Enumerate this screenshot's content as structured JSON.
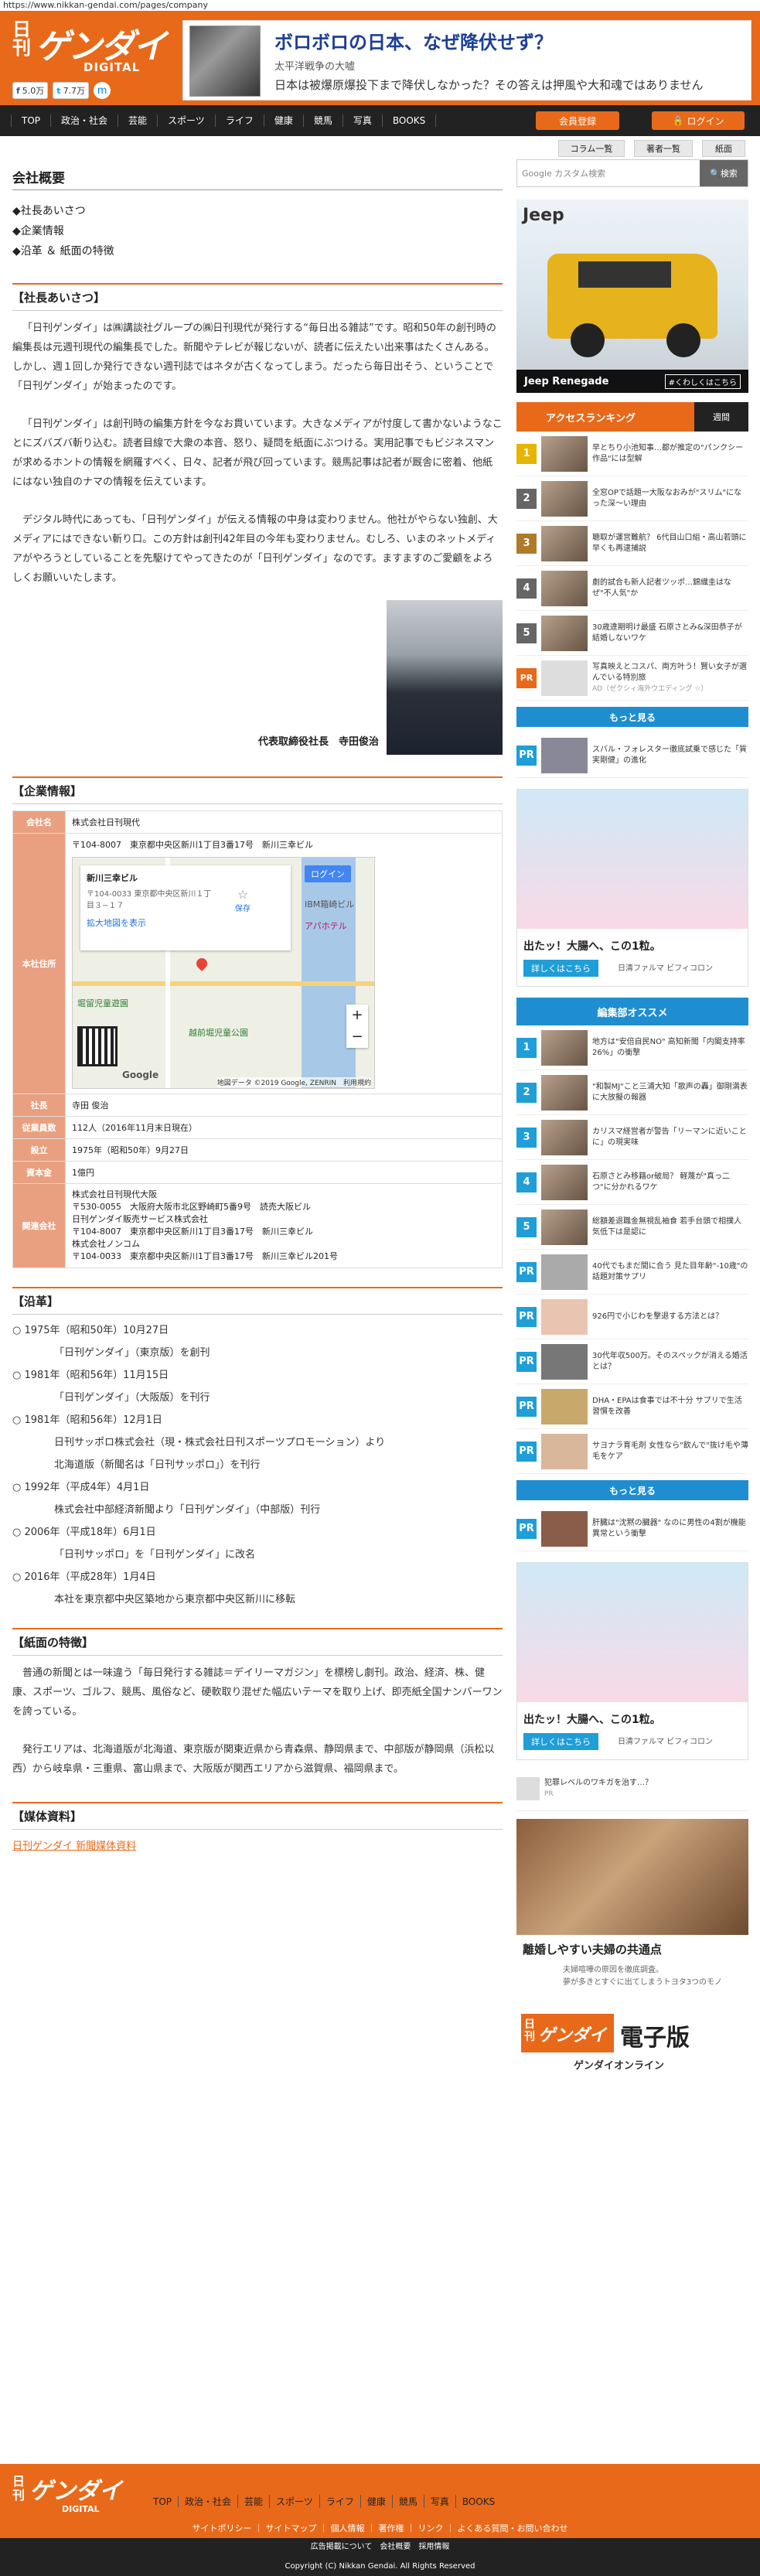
{
  "url": "https://www.nikkan-gendai.com/pages/company",
  "logo": {
    "nikkan": "日刊",
    "gendai": "ゲンダイ",
    "digital": "DIGITAL"
  },
  "social": {
    "fb_label": "f",
    "fb_count": "5.0万",
    "tw_label": "t",
    "tw_count": "7.7万",
    "messenger": "m"
  },
  "promo": {
    "headline": "ボロボロの日本、なぜ降伏せず？",
    "subtitle": "太平洋戦争の大嘘",
    "desc": "日本は被爆原爆投下まで降伏しなかった？その答えは押風や大和魂ではありません"
  },
  "nav": {
    "items": [
      "TOP",
      "政治・社会",
      "芸能",
      "スポーツ",
      "ライフ",
      "健康",
      "競馬",
      "写真",
      "BOOKS"
    ],
    "register": "会員登録",
    "login": "ログイン"
  },
  "subnav": [
    "コラム一覧",
    "著者一覧",
    "紙面"
  ],
  "page_title": "会社概要",
  "toc": [
    "◆社長あいさつ",
    "◆企業情報",
    "◆沿革 ＆ 紙面の特徴"
  ],
  "greeting": {
    "heading": "【社長あいさつ】",
    "p1": "「日刊ゲンダイ」は㈱講談社グループの㈱日刊現代が発行する“毎日出る雑誌”です。昭和50年の創刊時の編集長は元週刊現代の編集長でした。新聞やテレビが報じないが、読者に伝えたい出来事はたくさんある。しかし、週１回しか発行できない週刊誌ではネタが古くなってしまう。だったら毎日出そう、ということで「日刊ゲンダイ」が始まったのです。",
    "p2": "「日刊ゲンダイ」は創刊時の編集方針を今なお貫いています。大きなメディアが忖度して書かないようなことにズバズバ斬り込む。読者目線で大衆の本音、怒り、疑問を紙面にぶつける。実用記事でもビジネスマンが求めるホントの情報を網羅すべく、日々、記者が飛び回っています。競馬記事は記者が厩舎に密着、他紙にはない独自のナマの情報を伝えています。",
    "p3": "デジタル時代にあっても、「日刊ゲンダイ」が伝える情報の中身は変わりません。他社がやらない独創、大メディアにはできない斬り口。この方針は創刊42年目の今年も変わりません。むしろ、いまのネットメディアがやろうとしていることを先駆けてやってきたのが「日刊ゲンダイ」なのです。ますますのご愛顧をよろしくお願いいたします。",
    "signature": "代表取締役社長　寺田俊治"
  },
  "company": {
    "heading": "【企業情報】",
    "rows": [
      {
        "k": "会社名",
        "v": "株式会社日刊現代"
      },
      {
        "k": "本社住所",
        "v": "〒104-8007　東京都中央区新川1丁目3番17号　新川三幸ビル"
      },
      {
        "k": "社長",
        "v": "寺田 俊治"
      },
      {
        "k": "従業員数",
        "v": "112人（2016年11月末日現在）"
      },
      {
        "k": "設立",
        "v": "1975年（昭和50年）9月27日"
      },
      {
        "k": "資本金",
        "v": "1億円"
      }
    ],
    "map": {
      "place": "新川三幸ビル",
      "addr": "〒104-0033 東京都中央区新川１丁目３−１７",
      "save": "保存",
      "login": "ログイン",
      "enlarge": "拡大地図を表示",
      "ibm": "IBM箱崎ビル",
      "park": "堀留児童遊園",
      "station": "越前堀児童公園",
      "hotel": "アパホテル",
      "copy": "地図データ ©2019 Google, ZENRIN　利用規約",
      "google": "Google"
    },
    "related_k": "関連会社",
    "related": [
      "株式会社日刊現代大阪",
      "〒530-0055　大阪府大阪市北区野崎町5番9号　読売大阪ビル",
      "日刊ゲンダイ販売サービス株式会社",
      "〒104-8007　東京都中央区新川1丁目3番17号　新川三幸ビル",
      "株式会社ノンコム",
      "〒104-0033　東京都中央区新川1丁目3番17号　新川三幸ビル201号"
    ]
  },
  "history": {
    "heading": "【沿革】",
    "items": [
      {
        "date": "○ 1975年（昭和50年）10月27日",
        "desc": "「日刊ゲンダイ」（東京版）を創刊"
      },
      {
        "date": "○ 1981年（昭和56年）11月15日",
        "desc": "「日刊ゲンダイ」（大阪版）を刊行"
      },
      {
        "date": "○ 1981年（昭和56年）12月1日",
        "desc": "日刊サッポロ株式会社（現・株式会社日刊スポーツプロモーション）より",
        "desc2": "北海道版（新聞名は「日刊サッポロ」）を刊行"
      },
      {
        "date": "○ 1992年（平成4年）4月1日",
        "desc": "株式会社中部経済新聞より「日刊ゲンダイ」（中部版）刊行"
      },
      {
        "date": "○ 2006年（平成18年）6月1日",
        "desc": "「日刊サッポロ」を「日刊ゲンダイ」に改名"
      },
      {
        "date": "○ 2016年（平成28年）1月4日",
        "desc": "本社を東京都中央区築地から東京都中央区新川に移転"
      }
    ]
  },
  "features": {
    "heading": "【紙面の特徴】",
    "p1": "普通の新聞とは一味違う「毎日発行する雑誌＝デイリーマガジン」を標榜し劇刊。政治、経済、株、健康、スポーツ、ゴルフ、競馬、風俗など、硬軟取り混ぜた幅広いテーマを取り上げ、即売紙全国ナンバーワンを誇っている。",
    "p2": "発行エリアは、北海道版が北海道、東京版が関東近県から青森県、静岡県まで、中部版が静岡県（浜松以西）から岐阜県・三重県、富山県まで、大阪版が関西エリアから滋賀県、福岡県まで。"
  },
  "media": {
    "heading": "【媒体資料】",
    "link": "日刊ゲンダイ 新聞媒体資料"
  },
  "sidebar": {
    "search_placeholder": "Google カスタム検索",
    "search_btn": "検索",
    "jeep": {
      "logo": "Jeep",
      "name": "Jeep Renegade",
      "more": "#くわしくはこちら"
    },
    "ranking_title": "アクセスランキング",
    "ranking_tab": "週間",
    "ranking": [
      {
        "n": "1",
        "t": "早とちり小池知事…都が推定の\"パンクシー作品\"には型解"
      },
      {
        "n": "2",
        "t": "全窓OPで話題一大阪なおみが\"スリム\"になった深〜い理由"
      },
      {
        "n": "3",
        "t": "聴取が運営難航？ 6代目山口組・高山若頭に早くも再逮捕説"
      },
      {
        "n": "4",
        "t": "劇的試合も新人記者ツッポ…錦織圭はなぜ\"不人気\"か"
      },
      {
        "n": "5",
        "t": "30歳違期明け最盛 石原さとみ&深田恭子が結婚しないワケ"
      },
      {
        "n": "PR",
        "t": "写真映えとコスパ、両方叶う！賢い女子が選んでいる特別旅",
        "src": "AD（ゼクシィ海外ウエディング ☆）"
      }
    ],
    "more": "もっと見る",
    "pr_item": "スバル・フォレスター徹底試乗で感じた「質実剛健」の進化",
    "ad_text": "出たッ！大腸へ、この1粒。",
    "ad_btn": "詳しくはこちら",
    "ad_brand": "日清ファルマ ビフィコロン",
    "henshu_title": "編集部オススメ",
    "henshu": [
      {
        "n": "1",
        "t": "地方は\"安倍自民NO\" 高知新聞「内閣支持率26%」の衝撃"
      },
      {
        "n": "2",
        "t": "\"和製MJ\"こと三浦大知「歌声の轟」御剛満表に大放擬の報器"
      },
      {
        "n": "3",
        "t": "カリスマ経営者が警告「リーマンに近いことに」の現実味"
      },
      {
        "n": "4",
        "t": "石原さとみ移籍or破局？ 軽蔑が\"真っ二つ\"に分かれるワケ"
      },
      {
        "n": "5",
        "t": "総額差退職金無視乱袖食 若手台頭で相撲人気低下は是認に"
      },
      {
        "n": "PR",
        "t": "40代でもまだ間に合う 見た目年齢\"-10歳\"の話題対策サプリ"
      },
      {
        "n": "PR",
        "t": "926円で小じわを撃退する方法とは？"
      },
      {
        "n": "PR",
        "t": "30代年収500万。そのスペックが消える婚活とは？"
      },
      {
        "n": "PR",
        "t": "DHA・EPAは食事では不十分 サプリで生活習慣を改善"
      },
      {
        "n": "PR",
        "t": "サヨナラ育毛剤 女性なら\"飲んで\"抜け毛や薄毛をケア"
      }
    ],
    "more2": "もっと見る",
    "pr2": "肝臓は\"沈黙の臓器\" なのに男性の4割が機能異常という衝撃",
    "pr3": "犯罪レベルのワキガを治す…？",
    "pr3src": "PR",
    "storage_title": "離婚しやすい夫婦の共通点",
    "storage_sub": "夫婦喧嘩の原因を徹底調査。",
    "storage_desc": "夢が多きとすぐに出てしまうトヨタ3つのモノ",
    "epaper": {
      "nikkan": "日刊",
      "gendai": "ゲンダイ",
      "denshi": "電子版",
      "online": "ゲンダイオンライン"
    }
  },
  "footer": {
    "nav": [
      "TOP",
      "政治・社会",
      "芸能",
      "スポーツ",
      "ライフ",
      "健康",
      "競馬",
      "写真",
      "BOOKS"
    ],
    "links": "サイトポリシー ｜ サイトマップ ｜ 個人情報 ｜ 著作権 ｜ リンク ｜ よくある質問・お問い合わせ",
    "links2": "広告掲載について　会社概要　採用情報",
    "copyright": "Copyright (C) Nikkan Gendai. All Rights Reserved"
  },
  "colors": {
    "brand": "#e8691a",
    "nav": "#222222",
    "accent_blue": "#1f8ed0",
    "label_salmon": "#e8a080"
  }
}
